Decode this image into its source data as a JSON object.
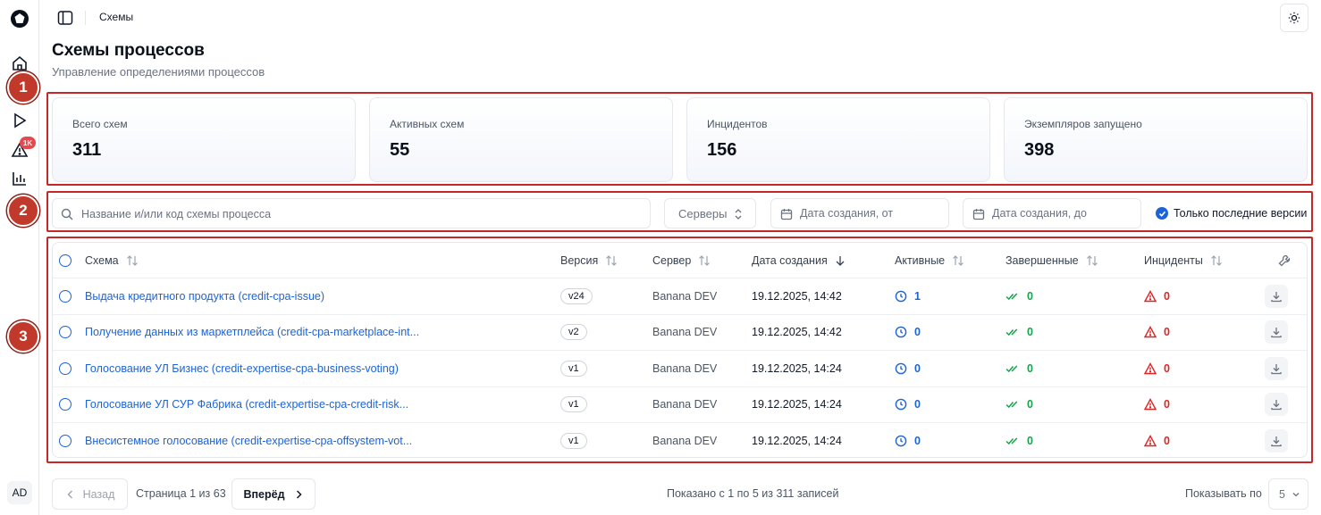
{
  "breadcrumb": "Схемы",
  "page": {
    "title": "Схемы процессов",
    "subtitle": "Управление определениями процессов"
  },
  "nav": {
    "items": [
      "home-icon",
      "play-icon",
      "alert-icon",
      "chart-icon"
    ],
    "alert_badge": "1K",
    "avatar": "AD"
  },
  "callouts": [
    "1",
    "2",
    "3"
  ],
  "stats": [
    {
      "label": "Всего схем",
      "value": "311"
    },
    {
      "label": "Активных схем",
      "value": "55"
    },
    {
      "label": "Инцидентов",
      "value": "156"
    },
    {
      "label": "Экземпляров запущено",
      "value": "398"
    }
  ],
  "filters": {
    "search_placeholder": "Название и/или код схемы процесса",
    "servers": "Серверы",
    "date_from": "Дата создания, от",
    "date_to": "Дата создания, до",
    "latest_only": "Только последние версии"
  },
  "table": {
    "columns": {
      "scheme": "Схема",
      "version": "Версия",
      "server": "Сервер",
      "created": "Дата создания",
      "active": "Активные",
      "completed": "Завершенные",
      "incidents": "Инциденты"
    },
    "rows": [
      {
        "scheme": "Выдача  кредитного продукта (credit-cpa-issue)",
        "version": "v24",
        "server": "Banana DEV",
        "created": "19.12.2025, 14:42",
        "active": "1",
        "completed": "0",
        "incidents": "0"
      },
      {
        "scheme": "Получение данных из маркетплейса (credit-cpa-marketplace-int...",
        "version": "v2",
        "server": "Banana DEV",
        "created": "19.12.2025, 14:42",
        "active": "0",
        "completed": "0",
        "incidents": "0"
      },
      {
        "scheme": "Голосование УЛ Бизнес (credit-expertise-cpa-business-voting)",
        "version": "v1",
        "server": "Banana DEV",
        "created": "19.12.2025, 14:24",
        "active": "0",
        "completed": "0",
        "incidents": "0"
      },
      {
        "scheme": "Голосование УЛ СУР Фабрика (credit-expertise-cpa-credit-risk...",
        "version": "v1",
        "server": "Banana DEV",
        "created": "19.12.2025, 14:24",
        "active": "0",
        "completed": "0",
        "incidents": "0"
      },
      {
        "scheme": "Внесистемное голосование (credit-expertise-cpa-offsystem-vot...",
        "version": "v1",
        "server": "Banana DEV",
        "created": "19.12.2025, 14:24",
        "active": "0",
        "completed": "0",
        "incidents": "0"
      }
    ]
  },
  "pager": {
    "prev": "Назад",
    "page_info": "Страница 1 из 63",
    "next": "Вперёд",
    "records": "Показано с 1 по 5 из 311 записей",
    "per_page_label": "Показывать по",
    "per_page": "5"
  },
  "colors": {
    "accent": "#1e63d6",
    "success": "#16a34a",
    "danger": "#dc2626",
    "callout": "#c0392b"
  }
}
